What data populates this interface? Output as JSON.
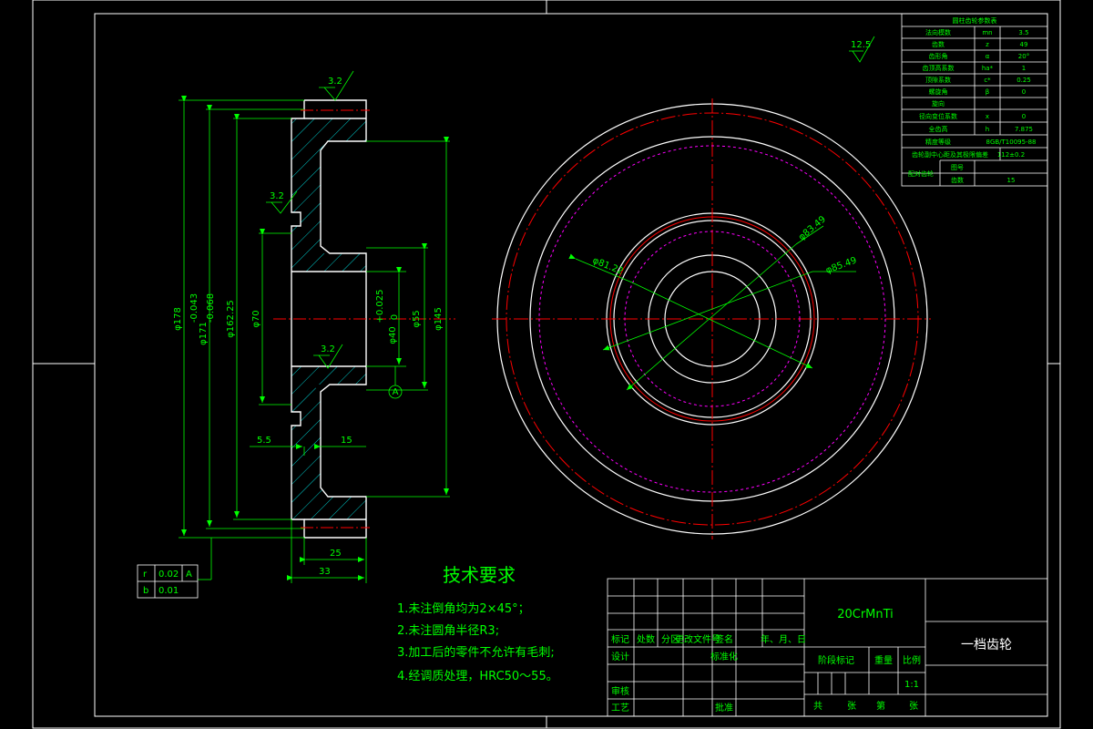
{
  "surface_symbols": {
    "global": "12.5",
    "top": "3.2",
    "left_upper": "3.2",
    "bore": "3.2"
  },
  "section_view": {
    "dims": {
      "d178": "φ178",
      "d171": "φ171",
      "d171_tol_upper": "-0.043",
      "d171_tol_lower": "-0.068",
      "d162": "φ162.25",
      "d70": "φ70",
      "d40": "φ40",
      "d40_tol_upper": "+0.025",
      "d40_tol_lower": "0",
      "d55": "φ55",
      "d145": "φ145",
      "w5_5": "5.5",
      "w15": "15",
      "w25": "25",
      "w33": "33"
    },
    "datum": "A"
  },
  "front_view": {
    "dims": {
      "d81": "φ81.22",
      "d83": "φ83.49",
      "d85": "φ85.49"
    }
  },
  "tolerance_frame": {
    "rows": [
      [
        "r",
        "0.02",
        "A"
      ],
      [
        "b",
        "0.01",
        ""
      ]
    ]
  },
  "gear_params": {
    "title": "圆柱齿轮参数表",
    "rows": [
      [
        "法向模数",
        "mn",
        "3.5"
      ],
      [
        "齿数",
        "z",
        "49"
      ],
      [
        "齿形角",
        "α",
        "20°"
      ],
      [
        "齿顶高系数",
        "ha*",
        "1"
      ],
      [
        "顶隙系数",
        "c*",
        "0.25"
      ],
      [
        "螺旋角",
        "β",
        "0"
      ],
      [
        "旋向",
        "",
        ""
      ],
      [
        "径向变位系数",
        "x",
        "0"
      ],
      [
        "全齿高",
        "h",
        "7.875"
      ],
      [
        "精度等级",
        "",
        "8GB/T10095-88"
      ],
      [
        "齿轮副中心距及其极限偏差",
        "a±fa",
        "112±0.2"
      ],
      [
        "配对齿轮",
        "图号",
        ""
      ],
      [
        "",
        "齿数",
        "15"
      ]
    ]
  },
  "tech_requirements": {
    "title": "技术要求",
    "items": [
      "1.未注倒角均为2×45°；",
      "2.未注圆角半径R3;",
      "3.加工后的零件不允许有毛刺;",
      "4.经调质处理，HRC50～55。"
    ]
  },
  "title_block": {
    "material": "20CrMnTi",
    "part_name": "一档齿轮",
    "revision_headers": [
      "标记",
      "处数",
      "分区",
      "更改文件号",
      "签名",
      "年、月、日"
    ],
    "design": "设计",
    "standardization": "标准化",
    "review": "审核",
    "process": "工艺",
    "approve": "批准",
    "stage_mark": "阶段标记",
    "weight": "重量",
    "scale_label": "比例",
    "scale": "1:1",
    "sheets_total": "共",
    "sheet_unit": "张",
    "sheet_no": "第",
    "sheet_unit2": "张"
  },
  "colors": {
    "outline": "#ffffff",
    "dimension": "#00ff00",
    "centerline": "#ff0000",
    "hidden_circle": "#ff00ff",
    "hatch": "#00ffff"
  }
}
